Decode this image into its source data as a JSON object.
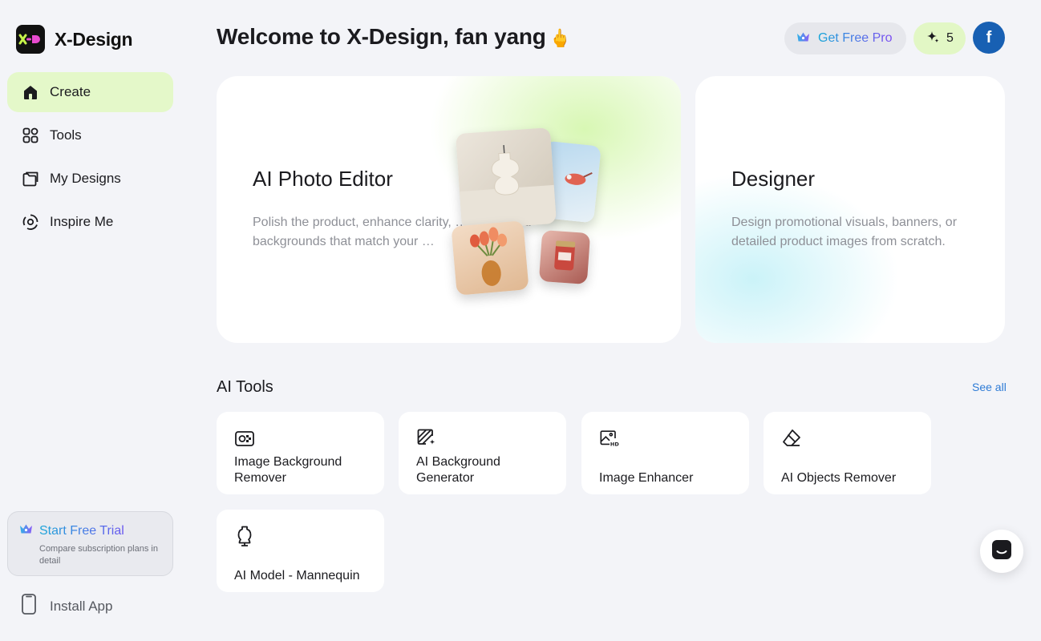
{
  "app": {
    "name": "X-Design"
  },
  "sidebar": {
    "items": [
      {
        "label": "Create",
        "icon": "home-icon",
        "active": true
      },
      {
        "label": "Tools",
        "icon": "grid-icon"
      },
      {
        "label": "My Designs",
        "icon": "folder-icon"
      },
      {
        "label": "Inspire Me",
        "icon": "inspire-icon"
      }
    ],
    "trial": {
      "title": "Start Free Trial",
      "subtitle": "Compare subscription plans in detail"
    },
    "install": {
      "label": "Install App"
    }
  },
  "header": {
    "welcome": "Welcome to X-Design, fan yang",
    "welcome_emoji": "🖕",
    "pro_label": "Get Free Pro",
    "credits": "5",
    "avatar_letter": "f"
  },
  "hero": {
    "editor": {
      "title": "AI Photo Editor",
      "description": "Polish the product, enhance clarity, … with styled backgrounds that match your …"
    },
    "designer": {
      "title": "Designer",
      "description": "Design promotional visuals, banners, or detailed product images from scratch."
    }
  },
  "tools": {
    "title": "AI Tools",
    "see_all": "See all",
    "items": [
      {
        "label": "Image Background Remover",
        "icon": "background-remover-icon"
      },
      {
        "label": "AI Background Generator",
        "icon": "background-generator-icon"
      },
      {
        "label": "Image Enhancer",
        "icon": "hd-image-icon"
      },
      {
        "label": "AI Objects Remover",
        "icon": "eraser-icon"
      },
      {
        "label": "AI Model - Mannequin",
        "icon": "mannequin-icon"
      }
    ]
  },
  "colors": {
    "accent_green": "#e4f8c9",
    "brand_blue": "#1860b3",
    "link": "#2e7bd6"
  }
}
